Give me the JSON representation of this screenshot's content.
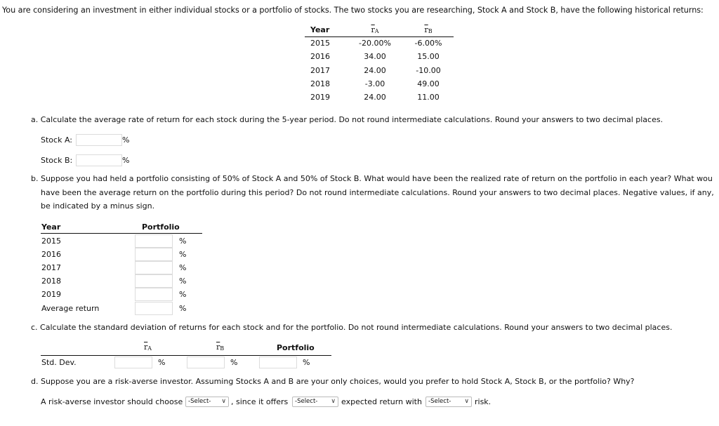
{
  "intro": "You are considering an investment in either individual stocks or a portfolio of stocks. The two stocks you are researching, Stock A and Stock B, have the following historical returns:",
  "history": {
    "headers": {
      "year": "Year",
      "a_symbol": "r",
      "a_sub": "A",
      "b_symbol": "r",
      "b_sub": "B"
    },
    "rows": [
      {
        "year": "2015",
        "a": "-20.00%",
        "b": "-6.00%"
      },
      {
        "year": "2016",
        "a": "34.00",
        "b": "15.00"
      },
      {
        "year": "2017",
        "a": "24.00",
        "b": "-10.00"
      },
      {
        "year": "2018",
        "a": "-3.00",
        "b": "49.00"
      },
      {
        "year": "2019",
        "a": "24.00",
        "b": "11.00"
      }
    ]
  },
  "part_a": {
    "question": "a. Calculate the average rate of return for each stock during the 5-year period. Do not round intermediate calculations. Round your answers to two decimal places.",
    "stock_a_label": "Stock A:",
    "stock_b_label": "Stock B:",
    "stock_a_value": "",
    "stock_b_value": "",
    "unit": "%"
  },
  "part_b": {
    "line1": "b. Suppose you had held a portfolio consisting of 50% of Stock A and 50% of Stock B. What would have been the realized rate of return on the portfolio in each year? What wou",
    "line2": "have been the average return on the portfolio during this period? Do not round intermediate calculations. Round your answers to two decimal places. Negative values, if any,",
    "line3": "be indicated by a minus sign.",
    "header_year": "Year",
    "header_portfolio": "Portfolio",
    "rows": [
      {
        "label": "2015",
        "value": ""
      },
      {
        "label": "2016",
        "value": ""
      },
      {
        "label": "2017",
        "value": ""
      },
      {
        "label": "2018",
        "value": ""
      },
      {
        "label": "2019",
        "value": ""
      },
      {
        "label": "Average return",
        "value": ""
      }
    ],
    "unit": "%"
  },
  "part_c": {
    "question": "c. Calculate the standard deviation of returns for each stock and for the portfolio. Do not round intermediate calculations. Round your answers to two decimal places.",
    "header_a_symbol": "r",
    "header_a_sub": "A",
    "header_b_symbol": "r",
    "header_b_sub": "B",
    "header_portfolio": "Portfolio",
    "row_label": "Std. Dev.",
    "a_value": "",
    "b_value": "",
    "p_value": "",
    "unit": "%"
  },
  "part_d": {
    "question": "d. Suppose you are a risk-averse investor. Assuming Stocks A and B are your only choices, would you prefer to hold Stock A, Stock B, or the portfolio? Why?",
    "text1": "A risk-averse investor should choose",
    "text2": ", since it offers",
    "text3": "expected return with",
    "text4": "risk.",
    "select1": "-Select-",
    "select2": "-Select-",
    "select3": "-Select-",
    "chevron": "∨"
  }
}
